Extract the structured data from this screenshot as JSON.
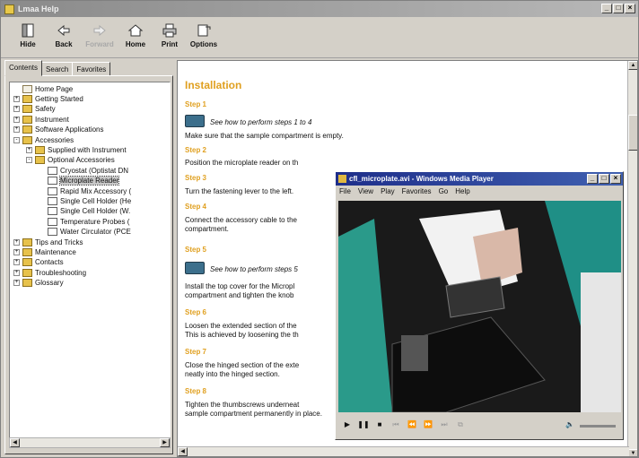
{
  "app": {
    "title": "Lmaa Help"
  },
  "window_buttons": [
    "_",
    "□",
    "×"
  ],
  "toolbar": [
    {
      "id": "hide",
      "label": "Hide",
      "enabled": true,
      "icon": "hide-icon"
    },
    {
      "id": "back",
      "label": "Back",
      "enabled": true,
      "icon": "back-arrow-icon"
    },
    {
      "id": "forward",
      "label": "Forward",
      "enabled": false,
      "icon": "forward-arrow-icon"
    },
    {
      "id": "home",
      "label": "Home",
      "enabled": true,
      "icon": "home-icon"
    },
    {
      "id": "print",
      "label": "Print",
      "enabled": true,
      "icon": "printer-icon"
    },
    {
      "id": "options",
      "label": "Options",
      "enabled": true,
      "icon": "options-icon"
    }
  ],
  "tabs": [
    "Contents",
    "Search",
    "Favorites"
  ],
  "tree": [
    {
      "label": "Home Page",
      "type": "home",
      "level": 0,
      "exp": ""
    },
    {
      "label": "Getting Started",
      "type": "book",
      "level": 0,
      "exp": "+"
    },
    {
      "label": "Safety",
      "type": "book",
      "level": 0,
      "exp": "+"
    },
    {
      "label": "Instrument",
      "type": "book",
      "level": 0,
      "exp": "+"
    },
    {
      "label": "Software Applications",
      "type": "book",
      "level": 0,
      "exp": "+"
    },
    {
      "label": "Accessories",
      "type": "book",
      "level": 0,
      "exp": "-"
    },
    {
      "label": "Supplied with Instrument",
      "type": "book",
      "level": 1,
      "exp": "+"
    },
    {
      "label": "Optional Accessories",
      "type": "book",
      "level": 1,
      "exp": "-"
    },
    {
      "label": "Cryostat (Optistat DN",
      "type": "page",
      "level": 2,
      "exp": ""
    },
    {
      "label": "Microplate Reader",
      "type": "page",
      "level": 2,
      "exp": "",
      "selected": true
    },
    {
      "label": "Rapid Mix Accessory (",
      "type": "page",
      "level": 2,
      "exp": ""
    },
    {
      "label": "Single Cell Holder (He",
      "type": "page",
      "level": 2,
      "exp": ""
    },
    {
      "label": "Single Cell Holder (W.",
      "type": "page",
      "level": 2,
      "exp": ""
    },
    {
      "label": "Temperature Probes (",
      "type": "page",
      "level": 2,
      "exp": ""
    },
    {
      "label": "Water Circulator (PCE",
      "type": "page",
      "level": 2,
      "exp": ""
    },
    {
      "label": "Tips and Tricks",
      "type": "book",
      "level": 0,
      "exp": "+"
    },
    {
      "label": "Maintenance",
      "type": "book",
      "level": 0,
      "exp": "+"
    },
    {
      "label": "Contacts",
      "type": "book",
      "level": 0,
      "exp": "+"
    },
    {
      "label": "Troubleshooting",
      "type": "book",
      "level": 0,
      "exp": "+"
    },
    {
      "label": "Glossary",
      "type": "book",
      "level": 0,
      "exp": "+"
    }
  ],
  "content": {
    "heading": "Installation",
    "step1": "Step 1",
    "howto1": "See how to perform steps 1 to 4",
    "p1": "Make sure that the sample compartment is empty.",
    "step2": "Step 2",
    "p2": "Position the microplate reader on th",
    "step3": "Step 3",
    "p3": "Turn the fastening lever to the left.",
    "step4": "Step 4",
    "p4a": "Connect the accessory cable to the",
    "p4b": "compartment.",
    "step5": "Step 5",
    "howto5": "See how to perform steps 5",
    "p5a": "Install the top cover for the Micropl",
    "p5b": "compartment and tighten the knob",
    "step6": "Step 6",
    "p6a": "Loosen the extended section of the",
    "p6b": "This is achieved by loosening the th",
    "step7": "Step 7",
    "p7a": "Close the hinged section of the exte",
    "p7b": "neatly into the hinged section.",
    "step8": "Step 8",
    "p8a": "Tighten the thumbscrews underneat",
    "p8b": "sample compartment permanently in place."
  },
  "player": {
    "title": "cfl_microplate.avi - Windows Media Player",
    "menu": [
      "File",
      "View",
      "Play",
      "Favorites",
      "Go",
      "Help"
    ],
    "controls": [
      {
        "glyph": "▶",
        "name": "play-icon",
        "enabled": true
      },
      {
        "glyph": "❚❚",
        "name": "pause-icon",
        "enabled": true
      },
      {
        "glyph": "■",
        "name": "stop-icon",
        "enabled": true
      },
      {
        "glyph": "⏮",
        "name": "skip-back-icon",
        "enabled": false
      },
      {
        "glyph": "⏪",
        "name": "rewind-icon",
        "enabled": false
      },
      {
        "glyph": "⏩",
        "name": "fast-forward-icon",
        "enabled": false
      },
      {
        "glyph": "⏭",
        "name": "skip-forward-icon",
        "enabled": false
      },
      {
        "glyph": "⧉",
        "name": "marker-icon",
        "enabled": false
      }
    ]
  },
  "colors": {
    "step_heading": "#e0a020",
    "player_title": "#1e2e8a"
  }
}
